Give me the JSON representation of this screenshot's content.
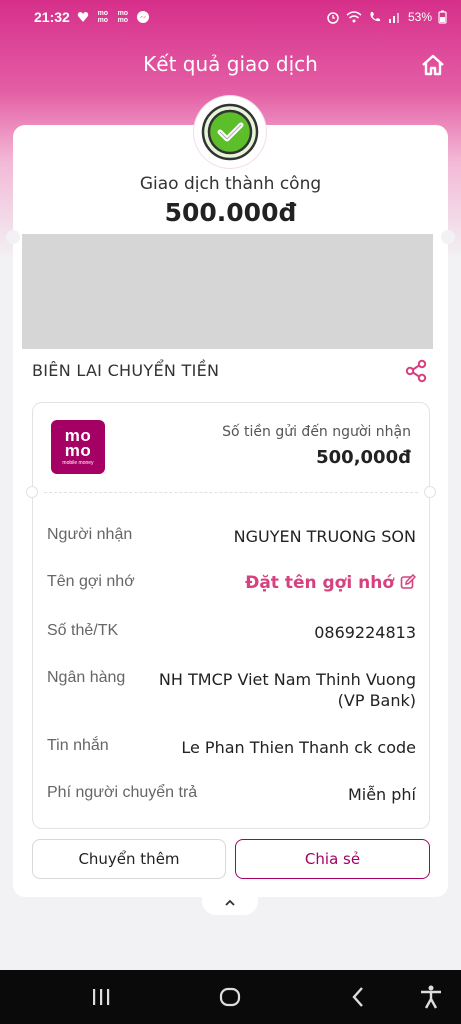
{
  "status_bar": {
    "time": "21:32",
    "app_logo_top": "mo",
    "app_logo_bottom": "mo",
    "battery": "53%"
  },
  "header": {
    "title": "Kết quả giao dịch"
  },
  "result": {
    "status_text": "Giao dịch thành công",
    "amount": "500.000đ"
  },
  "receipt": {
    "section_title": "BIÊN LAI CHUYỂN TIỀN",
    "logo": {
      "line1": "mo",
      "line2": "mo",
      "tagline": "mobile money"
    },
    "sent_label": "Số tiền gửi đến người nhận",
    "sent_amount": "500,000đ",
    "rows": [
      {
        "label": "Người nhận",
        "value": "NGUYEN TRUONG SON"
      },
      {
        "label": "Tên gợi nhớ",
        "value": "Đặt tên gợi nhớ"
      },
      {
        "label": "Số thẻ/TK",
        "value": "0869224813"
      },
      {
        "label": "Ngân hàng",
        "value_line1": "NH TMCP Viet Nam Thinh Vuong",
        "value_line2": "(VP Bank)"
      },
      {
        "label": "Tin nhắn",
        "value": "Le Phan Thien Thanh ck code"
      },
      {
        "label": "Phí người chuyển trả",
        "value": "Miễn phí"
      }
    ]
  },
  "actions": {
    "transfer_more": "Chuyển thêm",
    "share": "Chia sẻ"
  },
  "colors": {
    "brand": "#a50064",
    "accent_pink": "#d6427f",
    "success_green": "#5cbf2a"
  }
}
